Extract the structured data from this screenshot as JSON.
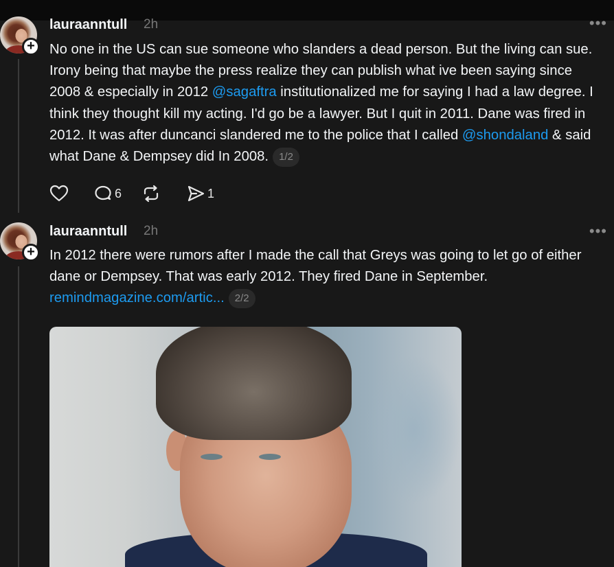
{
  "posts": [
    {
      "username": "lauraanntull",
      "time": "2h",
      "text_parts": [
        "No one in the US can sue someone who slanders a dead person. But the living can sue. Irony being that maybe the press realize they can publish what ive been saying since 2008 & especially in 2012 ",
        "@sagaftra",
        " institutionalized me for saying I had a law degree. I think they thought kill my acting. I'd go be a lawyer. But I quit in 2011. Dane was fired in 2012. It was after duncanci slandered me to the police that I called ",
        "@shondaland",
        " & said what Dane & Dempsey did In 2008."
      ],
      "pager": "1/2",
      "actions": {
        "like_count": "",
        "reply_count": "6",
        "repost_count": "",
        "share_count": "1"
      }
    },
    {
      "username": "lauraanntull",
      "time": "2h",
      "text": "In 2012 there were rumors after I made the call that Greys was going to let go of either dane or Dempsey. That was early 2012. They fired Dane in September.",
      "link": "remindmagazine.com/artic...",
      "pager": "2/2"
    }
  ],
  "icons": {
    "more": "more-horizontal-icon",
    "like": "heart-icon",
    "reply": "comment-icon",
    "repost": "repost-icon",
    "share": "send-icon",
    "follow": "plus-icon"
  },
  "colors": {
    "background": "#181818",
    "accent_link": "#1d9bf0",
    "muted": "#777777"
  }
}
